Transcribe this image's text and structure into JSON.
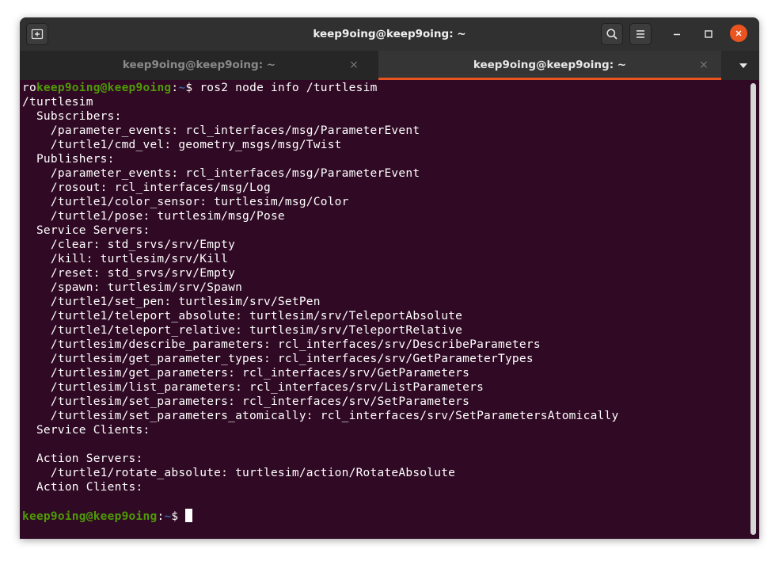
{
  "window": {
    "title": "keep9oing@keep9oing: ~"
  },
  "tabs": [
    {
      "label": "keep9oing@keep9oing: ~",
      "close": "×",
      "active": false
    },
    {
      "label": "keep9oing@keep9oing: ~",
      "close": "×",
      "active": true
    }
  ],
  "icons": {
    "new_tab": "new-tab-icon",
    "search": "search-icon",
    "menu": "hamburger-menu-icon",
    "minimize": "minimize-icon",
    "maximize": "maximize-icon",
    "close": "close-icon",
    "tabs_dropdown": "chevron-down-icon"
  },
  "colors": {
    "terminal_bg": "#300a24",
    "prompt_user": "#4e9a06",
    "prompt_path": "#3465a4",
    "accent": "#e95420"
  },
  "terminal": {
    "command_prefix": "ro",
    "prompt_user": "keep9oing@keep9oing",
    "prompt_colon": ":",
    "prompt_path": "~",
    "prompt_symbol": "$ ",
    "command": "ros2 node info /turtlesim",
    "output": [
      "/turtlesim",
      "  Subscribers:",
      "    /parameter_events: rcl_interfaces/msg/ParameterEvent",
      "    /turtle1/cmd_vel: geometry_msgs/msg/Twist",
      "  Publishers:",
      "    /parameter_events: rcl_interfaces/msg/ParameterEvent",
      "    /rosout: rcl_interfaces/msg/Log",
      "    /turtle1/color_sensor: turtlesim/msg/Color",
      "    /turtle1/pose: turtlesim/msg/Pose",
      "  Service Servers:",
      "    /clear: std_srvs/srv/Empty",
      "    /kill: turtlesim/srv/Kill",
      "    /reset: std_srvs/srv/Empty",
      "    /spawn: turtlesim/srv/Spawn",
      "    /turtle1/set_pen: turtlesim/srv/SetPen",
      "    /turtle1/teleport_absolute: turtlesim/srv/TeleportAbsolute",
      "    /turtle1/teleport_relative: turtlesim/srv/TeleportRelative",
      "    /turtlesim/describe_parameters: rcl_interfaces/srv/DescribeParameters",
      "    /turtlesim/get_parameter_types: rcl_interfaces/srv/GetParameterTypes",
      "    /turtlesim/get_parameters: rcl_interfaces/srv/GetParameters",
      "    /turtlesim/list_parameters: rcl_interfaces/srv/ListParameters",
      "    /turtlesim/set_parameters: rcl_interfaces/srv/SetParameters",
      "    /turtlesim/set_parameters_atomically: rcl_interfaces/srv/SetParametersAtomically",
      "  Service Clients:",
      "",
      "  Action Servers:",
      "    /turtle1/rotate_absolute: turtlesim/action/RotateAbsolute",
      "  Action Clients:",
      ""
    ]
  }
}
